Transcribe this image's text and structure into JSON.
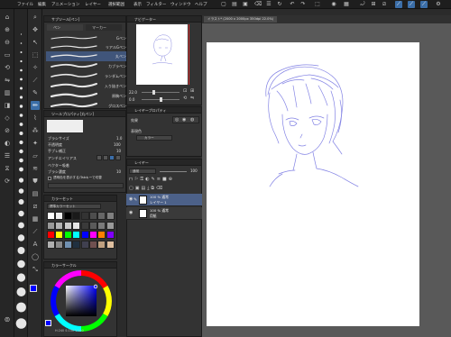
{
  "menubar": {
    "items": [
      "ファイル",
      "編集",
      "アニメーション",
      "レイヤー",
      "選択範囲",
      "表示",
      "フィルター",
      "ウィンドウ",
      "ヘルプ"
    ]
  },
  "subtool_panel": {
    "title_left": "サブツール[ペン]",
    "title_right": "ツールプロパティ",
    "tabs": [
      "ペン",
      "マーカー"
    ],
    "brushes": [
      "Gペン",
      "リアルGペン",
      "丸ペン",
      "カブラペン",
      "ランダムペン",
      "入り抜きペン",
      "原稿ペン",
      "グロスペン"
    ],
    "selected_index": 2
  },
  "tool_property": {
    "title": "ツールプロパティ[丸ペン]",
    "rows": [
      {
        "label": "ブラシサイズ",
        "value": "1.0"
      },
      {
        "label": "不透明度",
        "value": "100"
      },
      {
        "label": "手ブレ補正",
        "value": "10"
      },
      {
        "label": "アンチエイリアス",
        "value": ""
      },
      {
        "label": "ベクター吸着",
        "value": ""
      },
      {
        "label": "ブラシ濃度",
        "value": "10"
      }
    ],
    "checkbox_label": "透明色を表示する/Tabキーで切替"
  },
  "color_set": {
    "title": "カラーセット",
    "set_name": "標準カラーセット",
    "colors": [
      [
        "#ffffff",
        "#f0f0f0",
        "#000000",
        "#1a1a1a",
        "#333333",
        "#4d4d4d",
        "#666666",
        "#808080"
      ],
      [
        "#999999",
        "#b3b3b3",
        "#cccccc",
        "#e6e6e6",
        "#3a3a3a",
        "#5a5a5a",
        "#7a7a7a",
        "#9a9a9a"
      ],
      [
        "#ff0000",
        "#ffff00",
        "#00ff00",
        "#00ffff",
        "#0000ff",
        "#ff00ff",
        "#ff8000",
        "#8000ff"
      ],
      [
        "#b0b0b0",
        "#8a8a8a",
        "#7090b0",
        "#203040",
        "#404050",
        "#705050",
        "#c0a080",
        "#e0c0a0"
      ]
    ]
  },
  "color_wheel": {
    "title": "カラーサークル",
    "readout": "H:240 S:100 V:100"
  },
  "navigator": {
    "title": "ナビゲーター",
    "zoom": "22.0",
    "rotate": "0.0"
  },
  "layer_property": {
    "title": "レイヤープロパティ",
    "effect_label": "効果",
    "expression_label": "表現色",
    "expression_value": "カラー"
  },
  "layer_panel": {
    "title": "レイヤー",
    "blend": "通常",
    "opacity": "100",
    "layers": [
      {
        "name": "100 % 通常",
        "sub": "レイヤー 1",
        "selected": true
      },
      {
        "name": "100 % 通常",
        "sub": "用紙",
        "selected": false
      }
    ]
  },
  "canvas": {
    "tab_label": "イラスト* (2000 x 2000px 350dpi 22.0%)"
  },
  "colors": {
    "accent": "#3b6ea8",
    "main_color": "#0000ff",
    "sketch_line": "#6e6ee0"
  }
}
